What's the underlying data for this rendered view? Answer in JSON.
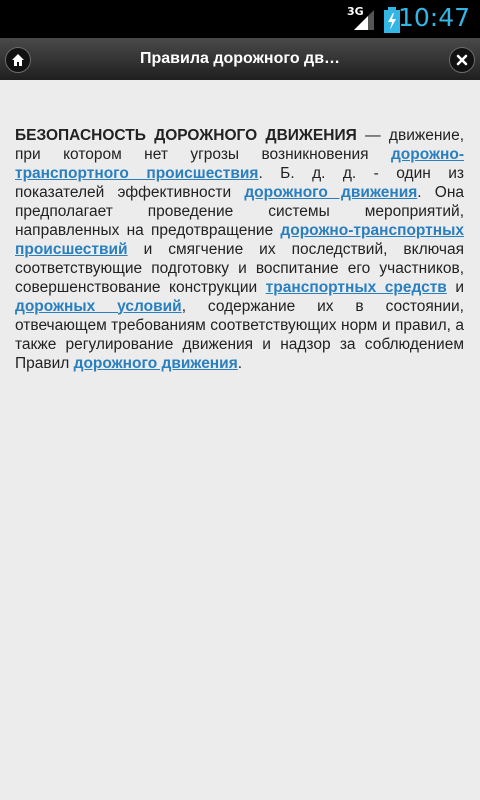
{
  "status_bar": {
    "network": "3G",
    "time": "10:47",
    "colors": {
      "accent": "#33b5e5"
    }
  },
  "action_bar": {
    "title": "Правила дорожного дв…",
    "home_icon": "home-icon",
    "close_icon": "close-icon"
  },
  "article": {
    "term": "БЕЗОПАСНОСТЬ ДОРОЖНОГО ДВИЖЕНИЯ",
    "seg1": " — движение, при котором нет угрозы возникновения ",
    "link1": "дорожно-транспортного происшествия",
    "seg2": ". Б. д. д. - один из показателей эффективности ",
    "link2": "дорожного движения",
    "seg3": ". Она предполагает проведение системы мероприятий, направленных на предотвращение ",
    "link3": "дорожно-транспортных происшествий",
    "seg4": " и смягчение их последствий, включая соответствующие подготовку и воспитание его участников, совершенствование конструкции ",
    "link4": "транспортных средств",
    "seg5": " и ",
    "link5": "дорожных условий",
    "seg6": ", содержание их в состоянии, отвечающем требованиям соответствующих норм и правил, а также регулирование движения и надзор за соблюдением Правил ",
    "link6": "дорожного движения",
    "seg7": ".",
    "link_color": "#2a7fbf"
  }
}
